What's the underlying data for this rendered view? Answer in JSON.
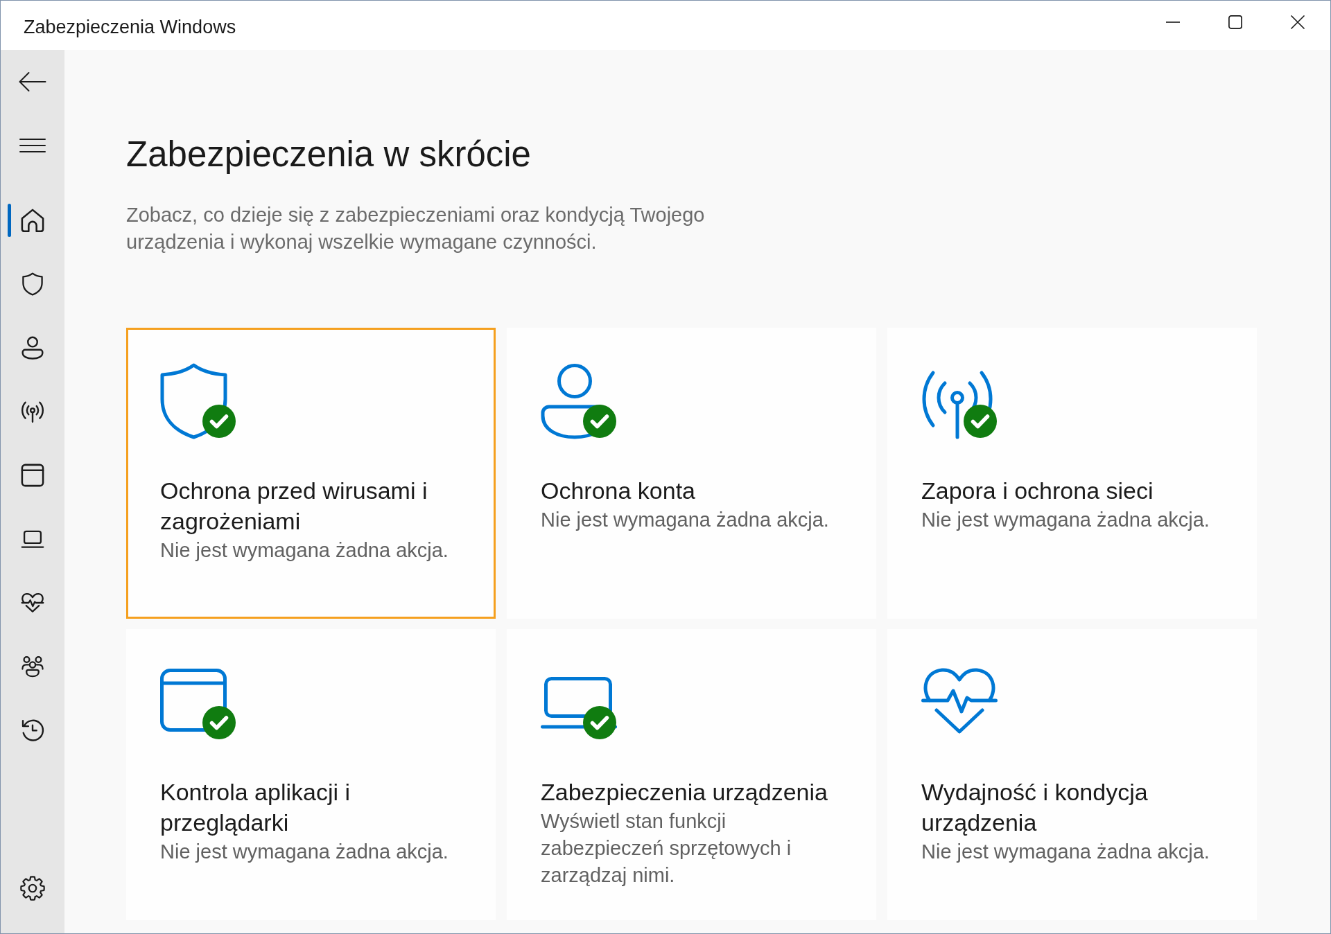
{
  "window": {
    "title": "Zabezpieczenia Windows"
  },
  "sidebar": {
    "nav": [
      {
        "selected": true
      },
      {
        "selected": false
      },
      {
        "selected": false
      },
      {
        "selected": false
      },
      {
        "selected": false
      },
      {
        "selected": false
      },
      {
        "selected": false
      },
      {
        "selected": false
      },
      {
        "selected": false
      }
    ]
  },
  "page": {
    "heading": "Zabezpieczenia w skrócie",
    "description": "Zobacz, co dzieje się z zabezpieczeniami oraz kondycją Twojego urządzenia i wykonaj wszelkie wymagane czynności."
  },
  "cards": [
    {
      "title": "Ochrona przed wirusami i zagrożeniami",
      "description": "Nie jest wymagana żadna akcja.",
      "checked": true,
      "focused": true
    },
    {
      "title": "Ochrona konta",
      "description": "Nie jest wymagana żadna akcja.",
      "checked": true,
      "focused": false
    },
    {
      "title": "Zapora i ochrona sieci",
      "description": "Nie jest wymagana żadna akcja.",
      "checked": true,
      "focused": false
    },
    {
      "title": "Kontrola aplikacji i przeglądarki",
      "description": "Nie jest wymagana żadna akcja.",
      "checked": true,
      "focused": false
    },
    {
      "title": "Zabezpieczenia urządzenia",
      "description": "Wyświetl stan funkcji zabezpieczeń sprzętowych i zarządzaj nimi.",
      "checked": true,
      "focused": false
    },
    {
      "title": "Wydajność i kondycja urządzenia",
      "description": "Nie jest wymagana żadna akcja.",
      "checked": false,
      "focused": false
    }
  ]
}
